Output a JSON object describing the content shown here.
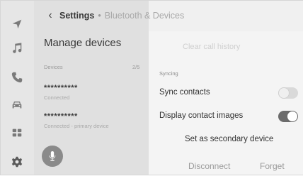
{
  "rail": {
    "icons": [
      "navigation-icon",
      "music-icon",
      "phone-icon",
      "car-icon",
      "apps-icon",
      "settings-icon"
    ]
  },
  "breadcrumb": {
    "current": "Settings",
    "separator": "•",
    "parent": "Bluetooth & Devices"
  },
  "panel": {
    "title": "Manage devices",
    "devices_label": "Devices",
    "devices_count": "2/5",
    "devices": [
      {
        "name": "**********",
        "status": "Connected"
      },
      {
        "name": "**********",
        "status": "Connected - primary device"
      }
    ]
  },
  "content": {
    "clear_history": "Clear call history",
    "syncing_label": "Syncing",
    "sync_contacts_label": "Sync contacts",
    "sync_contacts_on": false,
    "display_images_label": "Display contact images",
    "display_images_on": true,
    "secondary_button": "Set as secondary device",
    "disconnect_button": "Disconnect",
    "forget_button": "Forget"
  },
  "colors": {
    "rail": "#e6e6e6",
    "panel": "#e0e0e0",
    "toggle_on": "#6b6b6b",
    "toggle_off": "#d9d9d9"
  }
}
